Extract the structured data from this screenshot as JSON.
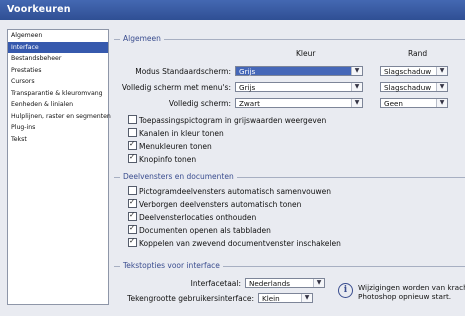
{
  "window": {
    "title": "Voorkeuren"
  },
  "sidebar": {
    "items": [
      {
        "label": "Algemeen",
        "selected": false
      },
      {
        "label": "Interface",
        "selected": true
      },
      {
        "label": "Bestandsbeheer",
        "selected": false
      },
      {
        "label": "Prestaties",
        "selected": false
      },
      {
        "label": "Cursors",
        "selected": false
      },
      {
        "label": "Transparantie & kleuromvang",
        "selected": false
      },
      {
        "label": "Eenheden & linialen",
        "selected": false
      },
      {
        "label": "Hulplijnen, raster en segmenten",
        "selected": false
      },
      {
        "label": "Plug-ins",
        "selected": false
      },
      {
        "label": "Tekst",
        "selected": false
      }
    ]
  },
  "general": {
    "title": "Algemeen",
    "col_color": "Kleur",
    "col_border": "Rand",
    "rows": [
      {
        "label": "Modus Standaardscherm:",
        "color": "Grijs",
        "border": "Slagschaduw"
      },
      {
        "label": "Volledig scherm met menu's:",
        "color": "Grijs",
        "border": "Slagschaduw"
      },
      {
        "label": "Volledig scherm:",
        "color": "Zwart",
        "border": "Geen"
      }
    ],
    "checks": [
      {
        "label": "Toepassingspictogram in grijswaarden weergeven",
        "checked": false
      },
      {
        "label": "Kanalen in kleur tonen",
        "checked": false
      },
      {
        "label": "Menukleuren tonen",
        "checked": true
      },
      {
        "label": "Knopinfo tonen",
        "checked": true
      }
    ]
  },
  "panels": {
    "title": "Deelvensters en documenten",
    "checks": [
      {
        "label": "Pictogramdeelvensters automatisch samenvouwen",
        "checked": false
      },
      {
        "label": "Verborgen deelvensters automatisch tonen",
        "checked": true
      },
      {
        "label": "Deelvensterlocaties onthouden",
        "checked": true
      },
      {
        "label": "Documenten openen als tabbladen",
        "checked": true
      },
      {
        "label": "Koppelen van zwevend documentvenster inschakelen",
        "checked": true
      }
    ]
  },
  "text_options": {
    "title": "Tekstopties voor interface",
    "language_label": "Interfacetaal:",
    "language_value": "Nederlands",
    "size_label": "Tekengrootte gebruikersinterface:",
    "size_value": "Klein",
    "note_line1": "Wijzigingen worden van krach",
    "note_line2": "Photoshop opnieuw start.",
    "info_icon": "i"
  }
}
